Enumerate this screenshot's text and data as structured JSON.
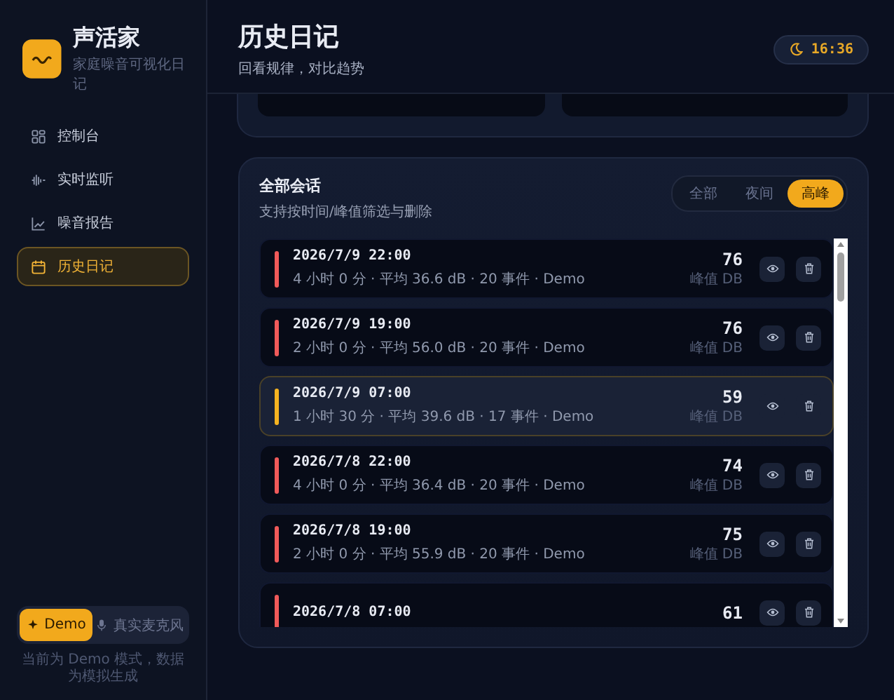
{
  "app": {
    "name": "声活家",
    "tagline": "家庭噪音可视化日记"
  },
  "nav": [
    {
      "label": "控制台",
      "kind": "grid",
      "selected": false
    },
    {
      "label": "实时监听",
      "kind": "wave",
      "selected": false
    },
    {
      "label": "噪音报告",
      "kind": "chart",
      "selected": false
    },
    {
      "label": "历史日记",
      "kind": "calendar",
      "selected": true
    }
  ],
  "mode": {
    "options": [
      {
        "label": "Demo",
        "kind": "demo",
        "selected": true
      },
      {
        "label": "真实麦克风",
        "kind": "mic",
        "selected": false
      }
    ],
    "note": "当前为 Demo 模式，数据为模拟生成"
  },
  "header": {
    "title": "历史日记",
    "subtitle": "回看规律，对比趋势",
    "clock": "16:36"
  },
  "sessions": {
    "title": "全部会话",
    "subtitle": "支持按时间/峰值筛选与删除",
    "filters": [
      {
        "label": "全部",
        "selected": false
      },
      {
        "label": "夜间",
        "selected": false
      },
      {
        "label": "高峰",
        "selected": true
      }
    ],
    "rows": [
      {
        "time": "2026/7/9 22:00",
        "meta": "4 小时 0 分 · 平均 36.6 dB · 20 事件 · Demo",
        "peak": "76",
        "peak_label": "峰值 DB",
        "color": "#f05a5a",
        "selected": false
      },
      {
        "time": "2026/7/9 19:00",
        "meta": "2 小时 0 分 · 平均 56.0 dB · 20 事件 · Demo",
        "peak": "76",
        "peak_label": "峰值 DB",
        "color": "#f05a5a",
        "selected": false
      },
      {
        "time": "2026/7/9 07:00",
        "meta": "1 小时 30 分 · 平均 39.6 dB · 17 事件 · Demo",
        "peak": "59",
        "peak_label": "峰值 DB",
        "color": "#f5b320",
        "selected": true
      },
      {
        "time": "2026/7/8 22:00",
        "meta": "4 小时 0 分 · 平均 36.4 dB · 20 事件 · Demo",
        "peak": "74",
        "peak_label": "峰值 DB",
        "color": "#f05a5a",
        "selected": false
      },
      {
        "time": "2026/7/8 19:00",
        "meta": "2 小时 0 分 · 平均 55.9 dB · 20 事件 · Demo",
        "peak": "75",
        "peak_label": "峰值 DB",
        "color": "#f05a5a",
        "selected": false
      },
      {
        "time": "2026/7/8 07:00",
        "peak": "61",
        "color": "#f05a5a",
        "selected": false
      }
    ]
  }
}
